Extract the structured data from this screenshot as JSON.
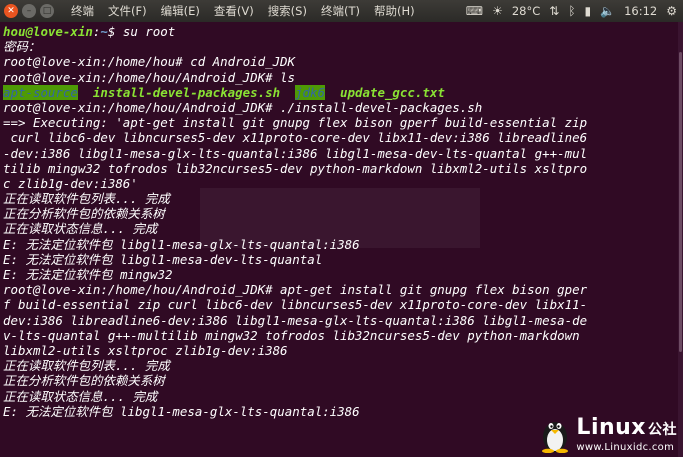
{
  "panel": {
    "menus": [
      "终端",
      "文件(F)",
      "编辑(E)",
      "查看(V)",
      "搜索(S)",
      "终端(T)",
      "帮助(H)"
    ],
    "weather_icon": "sun-icon",
    "temperature": "28°C",
    "time": "16:12"
  },
  "terminal": {
    "lines": [
      {
        "segments": [
          {
            "t": "hou@love-xin",
            "c": "prompt-user"
          },
          {
            "t": ":",
            "c": ""
          },
          {
            "t": "~",
            "c": "prompt-path"
          },
          {
            "t": "$ su root",
            "c": ""
          }
        ]
      },
      {
        "segments": [
          {
            "t": "密码：",
            "c": ""
          }
        ]
      },
      {
        "segments": [
          {
            "t": "root@love-xin:/home/hou# cd Android_JDK",
            "c": ""
          }
        ]
      },
      {
        "segments": [
          {
            "t": "root@love-xin:/home/hou/Android_JDK# ls",
            "c": ""
          }
        ]
      },
      {
        "segments": [
          {
            "t": "apt-source",
            "c": "ls-hl"
          },
          {
            "t": "  ",
            "c": ""
          },
          {
            "t": "install-devel-packages.sh",
            "c": "ls-exec"
          },
          {
            "t": "  ",
            "c": ""
          },
          {
            "t": "jdk6",
            "c": "ls-hl"
          },
          {
            "t": "  ",
            "c": ""
          },
          {
            "t": "update_gcc.txt",
            "c": "ls-exec"
          }
        ]
      },
      {
        "segments": [
          {
            "t": "root@love-xin:/home/hou/Android_JDK# ./install-devel-packages.sh",
            "c": ""
          }
        ]
      },
      {
        "segments": [
          {
            "t": "==> Executing: 'apt-get install git gnupg flex bison gperf build-essential zip",
            "c": ""
          }
        ]
      },
      {
        "segments": [
          {
            "t": " curl libc6-dev libncurses5-dev x11proto-core-dev libx11-dev:i386 libreadline6",
            "c": ""
          }
        ]
      },
      {
        "segments": [
          {
            "t": "-dev:i386 libgl1-mesa-glx-lts-quantal:i386 libgl1-mesa-dev-lts-quantal g++-mul",
            "c": ""
          }
        ]
      },
      {
        "segments": [
          {
            "t": "tilib mingw32 tofrodos lib32ncurses5-dev python-markdown libxml2-utils xsltpro",
            "c": ""
          }
        ]
      },
      {
        "segments": [
          {
            "t": "c zlib1g-dev:i386'",
            "c": ""
          }
        ]
      },
      {
        "segments": [
          {
            "t": "正在读取软件包列表... 完成",
            "c": ""
          }
        ]
      },
      {
        "segments": [
          {
            "t": "正在分析软件包的依赖关系树",
            "c": ""
          }
        ]
      },
      {
        "segments": [
          {
            "t": "正在读取状态信息... 完成",
            "c": ""
          }
        ]
      },
      {
        "segments": [
          {
            "t": "E: 无法定位软件包 libgl1-mesa-glx-lts-quantal:i386",
            "c": ""
          }
        ]
      },
      {
        "segments": [
          {
            "t": "E: 无法定位软件包 libgl1-mesa-dev-lts-quantal",
            "c": ""
          }
        ]
      },
      {
        "segments": [
          {
            "t": "E: 无法定位软件包 mingw32",
            "c": ""
          }
        ]
      },
      {
        "segments": [
          {
            "t": "root@love-xin:/home/hou/Android_JDK# apt-get install git gnupg flex bison gper",
            "c": ""
          }
        ]
      },
      {
        "segments": [
          {
            "t": "f build-essential zip curl libc6-dev libncurses5-dev x11proto-core-dev libx11-",
            "c": ""
          }
        ]
      },
      {
        "segments": [
          {
            "t": "dev:i386 libreadline6-dev:i386 libgl1-mesa-glx-lts-quantal:i386 libgl1-mesa-de",
            "c": ""
          }
        ]
      },
      {
        "segments": [
          {
            "t": "v-lts-quantal g++-multilib mingw32 tofrodos lib32ncurses5-dev python-markdown",
            "c": ""
          }
        ]
      },
      {
        "segments": [
          {
            "t": "libxml2-utils xsltproc zlib1g-dev:i386",
            "c": ""
          }
        ]
      },
      {
        "segments": [
          {
            "t": "正在读取软件包列表... 完成",
            "c": ""
          }
        ]
      },
      {
        "segments": [
          {
            "t": "正在分析软件包的依赖关系树",
            "c": ""
          }
        ]
      },
      {
        "segments": [
          {
            "t": "正在读取状态信息... 完成",
            "c": ""
          }
        ]
      },
      {
        "segments": [
          {
            "t": "E: 无法定位软件包 libgl1-mesa-glx-lts-quantal:i386",
            "c": ""
          }
        ]
      }
    ]
  },
  "logo": {
    "name": "Linux",
    "cn": "公社",
    "url": "www.Linuxidc.com"
  },
  "colors": {
    "terminal_bg": "#300a24",
    "prompt_green": "#8ae234",
    "prompt_blue": "#729fcf",
    "dir_highlight_bg": "#4e9a06",
    "close_button": "#e95420"
  }
}
